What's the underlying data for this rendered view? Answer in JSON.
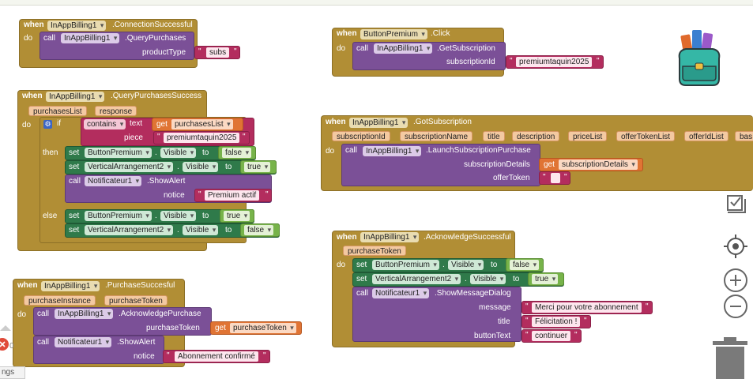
{
  "blocks": {
    "b1": {
      "when": "when",
      "component": "InAppBilling1",
      "event": ".ConnectionSuccessful",
      "do": "do",
      "call": "call",
      "method": ".QueryPurchases",
      "arg_label": "productType",
      "arg_value": "subs"
    },
    "b2": {
      "when": "when",
      "component": "InAppBilling1",
      "event": ".QueryPurchasesSuccess",
      "param1": "purchasesList",
      "param2": "response",
      "do": "do",
      "if": "if",
      "contains_op": "contains",
      "text_label": "text",
      "get": "get",
      "get_var": "purchasesList",
      "piece_label": "piece",
      "piece_value": "premiumtaquin2025",
      "then": "then",
      "else": "else",
      "set": "set",
      "to": "to",
      "comp_button": "ButtonPremium",
      "comp_arr": "VerticalArrangement2",
      "prop_visible": "Visible",
      "val_false": "false",
      "val_true": "true",
      "call": "call",
      "notif": "Notificateur1",
      "showalert": ".ShowAlert",
      "notice_label": "notice",
      "notice_value": "Premium actif"
    },
    "b3": {
      "when": "when",
      "component": "InAppBilling1",
      "event": ".PurchaseSuccesful",
      "param1": "purchaseInstance",
      "param2": "purchaseToken",
      "do": "do",
      "call": "call",
      "method": ".AcknowledgePurchase",
      "arg_label": "purchaseToken",
      "get": "get",
      "get_var": "purchaseToken",
      "notif": "Notificateur1",
      "showalert": ".ShowAlert",
      "notice_label": "notice",
      "notice_value": "Abonnement confirmé"
    },
    "b4": {
      "when": "when",
      "component": "ButtonPremium",
      "event": ".Click",
      "do": "do",
      "call": "call",
      "target": "InAppBilling1",
      "method": ".GetSubscription",
      "arg_label": "subscriptionId",
      "arg_value": "premiumtaquin2025"
    },
    "b5": {
      "when": "when",
      "component": "InAppBilling1",
      "event": ".GotSubscription",
      "params": [
        "subscriptionId",
        "subscriptionName",
        "title",
        "description",
        "priceList",
        "offerTokenList",
        "offerIdList",
        "bas"
      ],
      "do": "do",
      "call": "call",
      "target": "InAppBilling1",
      "method": ".LaunchSubscriptionPurchase",
      "arg1_label": "subscriptionDetails",
      "get": "get",
      "get_var": "subscriptionDetails",
      "arg2_label": "offerToken"
    },
    "b6": {
      "when": "when",
      "component": "InAppBilling1",
      "event": ".AcknowledgeSuccessful",
      "param1": "purchaseToken",
      "do": "do",
      "set": "set",
      "to": "to",
      "comp_button": "ButtonPremium",
      "comp_arr": "VerticalArrangement2",
      "prop_visible": "Visible",
      "val_false": "false",
      "val_true": "true",
      "call": "call",
      "notif": "Notificateur1",
      "method": ".ShowMessageDialog",
      "message_label": "message",
      "message_value": "Merci pour votre abonnement",
      "title_label": "title",
      "title_value": "Félicitation !",
      "button_label": "buttonText",
      "button_value": "continuer"
    }
  },
  "workspace": {
    "settings_fragment": "ngs",
    "counter_fragment": "0"
  },
  "colors": {
    "event": "#b18e35",
    "procedure": "#7b5097",
    "setter": "#2f7a4a",
    "text": "#b32d5e",
    "getter": "#e07434",
    "boolean": "#77b34a"
  }
}
